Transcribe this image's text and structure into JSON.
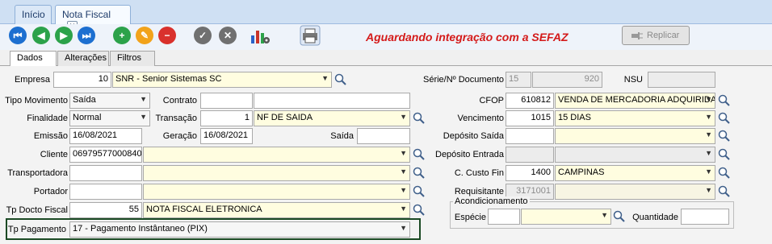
{
  "tabs": [
    {
      "label": "Início"
    },
    {
      "label": "Nota Fiscal"
    }
  ],
  "toolbar": {
    "status": "Aguardando integração com a SEFAZ",
    "replicar": "Replicar"
  },
  "subtabs": [
    {
      "label": "Dados"
    },
    {
      "label": "Alterações"
    },
    {
      "label": "Filtros"
    }
  ],
  "form": {
    "empresa": {
      "label": "Empresa",
      "code": "10",
      "name": "SNR - Senior Sistemas SC"
    },
    "serie": {
      "label": "Série/Nº Documento",
      "serie": "15",
      "numero": "920"
    },
    "nsu": {
      "label": "NSU",
      "value": ""
    },
    "tipo_movimento": {
      "label": "Tipo Movimento",
      "value": "Saída"
    },
    "contrato": {
      "label": "Contrato",
      "code": "",
      "name": ""
    },
    "cfop": {
      "label": "CFOP",
      "code": "610812",
      "name": "VENDA DE MERCADORIA ADQUIRIDA"
    },
    "finalidade": {
      "label": "Finalidade",
      "value": "Normal"
    },
    "transacao": {
      "label": "Transação",
      "code": "1",
      "name": "NF DE SAIDA"
    },
    "vencimento": {
      "label": "Vencimento",
      "code": "1015",
      "name": "15 DIAS"
    },
    "emissao": {
      "label": "Emissão",
      "value": "16/08/2021"
    },
    "geracao": {
      "label": "Geração",
      "value": "16/08/2021"
    },
    "saida": {
      "label": "Saída",
      "value": ""
    },
    "deposito_saida": {
      "label": "Depósito Saída",
      "code": "",
      "name": ""
    },
    "cliente": {
      "label": "Cliente",
      "code": "06979577000840",
      "name": ""
    },
    "deposito_entrada": {
      "label": "Depósito Entrada",
      "code": "",
      "name": ""
    },
    "transportadora": {
      "label": "Transportadora",
      "code": "",
      "name": ""
    },
    "custo": {
      "label": "C. Custo Fin",
      "code": "1400",
      "name": "CAMPINAS"
    },
    "portador": {
      "label": "Portador",
      "code": "",
      "name": ""
    },
    "requisitante": {
      "label": "Requisitante",
      "code": "3171001",
      "name": ""
    },
    "tp_docto": {
      "label": "Tp Docto Fiscal",
      "code": "55",
      "name": "NOTA FISCAL ELETRONICA"
    },
    "acond": {
      "label": "Acondicionamento",
      "especie_label": "Espécie",
      "especie_code": "",
      "especie_name": "",
      "quantidade_label": "Quantidade",
      "quantidade": ""
    },
    "tp_pagamento": {
      "label": "Tp Pagamento",
      "value": "17 - Pagamento Instântaneo (PIX)"
    }
  },
  "colors": {
    "status": "#d41a1a",
    "highlight": "#1b4a24",
    "yellow_field": "#fffde0"
  }
}
